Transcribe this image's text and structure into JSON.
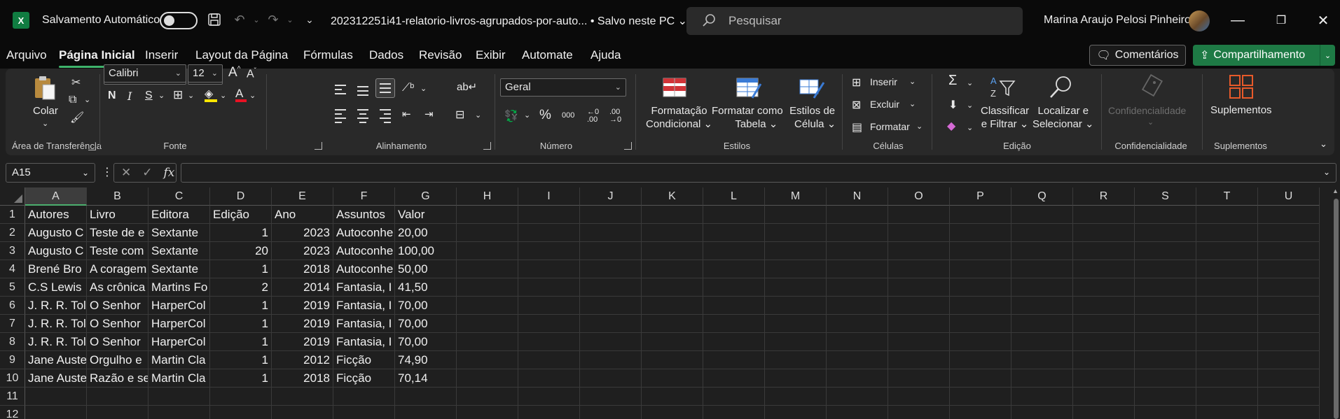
{
  "titlebar": {
    "logo_text": "X",
    "autosave_label": "Salvamento Automático",
    "doc_title": "202312251i41-relatorio-livros-agrupados-por-auto... • Salvo neste PC",
    "search_placeholder": "Pesquisar",
    "user_name": "Marina Araujo Pelosi Pinheiro"
  },
  "menu": {
    "tabs": [
      "Arquivo",
      "Página Inicial",
      "Inserir",
      "Layout da Página",
      "Fórmulas",
      "Dados",
      "Revisão",
      "Exibir",
      "Automate",
      "Ajuda"
    ],
    "active": "Página Inicial",
    "comments_label": "Comentários",
    "share_label": "Compartilhamento"
  },
  "ribbon": {
    "clipboard": {
      "paste_label": "Colar",
      "group": "Área de Transferência"
    },
    "font": {
      "name": "Calibri",
      "size": "12",
      "bold": "N",
      "italic": "I",
      "underline": "S",
      "group": "Fonte",
      "fill_color": "#ffe600",
      "font_color": "#e81123"
    },
    "alignment": {
      "group": "Alinhamento"
    },
    "number": {
      "format": "Geral",
      "percent": "%",
      "thousands": "000",
      "group": "Número"
    },
    "styles": {
      "conditional_line1": "Formatação",
      "conditional_line2": "Condicional",
      "table_line1": "Formatar como",
      "table_line2": "Tabela",
      "cell_line1": "Estilos de",
      "cell_line2": "Célula",
      "group": "Estilos"
    },
    "cells": {
      "insert": "Inserir",
      "delete": "Excluir",
      "format": "Formatar",
      "group": "Células"
    },
    "editing": {
      "sort_line1": "Classificar",
      "sort_line2": "e Filtrar",
      "find_line1": "Localizar e",
      "find_line2": "Selecionar",
      "group": "Edição"
    },
    "sensitivity": {
      "label": "Confidencialidade",
      "group": "Confidencialidade"
    },
    "addins": {
      "label": "Suplementos",
      "group": "Suplementos"
    }
  },
  "formula_bar": {
    "name_box": "A15",
    "fx": "fx",
    "formula": ""
  },
  "sheet": {
    "columns": [
      "A",
      "B",
      "C",
      "D",
      "E",
      "F",
      "G",
      "H",
      "I",
      "J",
      "K",
      "L",
      "M",
      "N",
      "O",
      "P",
      "Q",
      "R",
      "S",
      "T",
      "U"
    ],
    "selected_column": "A",
    "row_numbers": [
      "1",
      "2",
      "3",
      "4",
      "5",
      "6",
      "7",
      "8",
      "9",
      "10",
      "11",
      "12"
    ],
    "rows": [
      [
        "Autores",
        "Livro",
        "Editora",
        "Edição",
        "Ano",
        "Assuntos",
        "Valor"
      ],
      [
        "Augusto C",
        "Teste de e",
        "Sextante",
        "1",
        "2023",
        "Autoconhe",
        "20,00"
      ],
      [
        "Augusto C",
        "Teste com",
        "Sextante",
        "20",
        "2023",
        "Autoconhe",
        "100,00"
      ],
      [
        "Brené Bro",
        "A coragem",
        "Sextante",
        "1",
        "2018",
        "Autoconhe",
        "50,00"
      ],
      [
        "C.S Lewis",
        "As crônica",
        "Martins Fo",
        "2",
        "2014",
        "Fantasia, I",
        "41,50"
      ],
      [
        "J. R. R. Tol",
        "O Senhor",
        "HarperCol",
        "1",
        "2019",
        "Fantasia, I",
        "70,00"
      ],
      [
        "J. R. R. Tol",
        "O Senhor",
        "HarperCol",
        "1",
        "2019",
        "Fantasia, I",
        "70,00"
      ],
      [
        "J. R. R. Tol",
        "O Senhor",
        "HarperCol",
        "1",
        "2019",
        "Fantasia, I",
        "70,00"
      ],
      [
        "Jane Auste",
        "Orgulho e",
        "Martin Cla",
        "1",
        "2012",
        "Ficção",
        "74,90"
      ],
      [
        "Jane Auste",
        "Razão e se",
        "Martin Cla",
        "1",
        "2018",
        "Ficção",
        "70,14"
      ],
      [
        "",
        "",
        "",
        "",
        "",
        "",
        ""
      ],
      [
        "",
        "",
        "",
        "",
        "",
        "",
        ""
      ]
    ],
    "right_aligned_columns": [
      3,
      4
    ]
  }
}
